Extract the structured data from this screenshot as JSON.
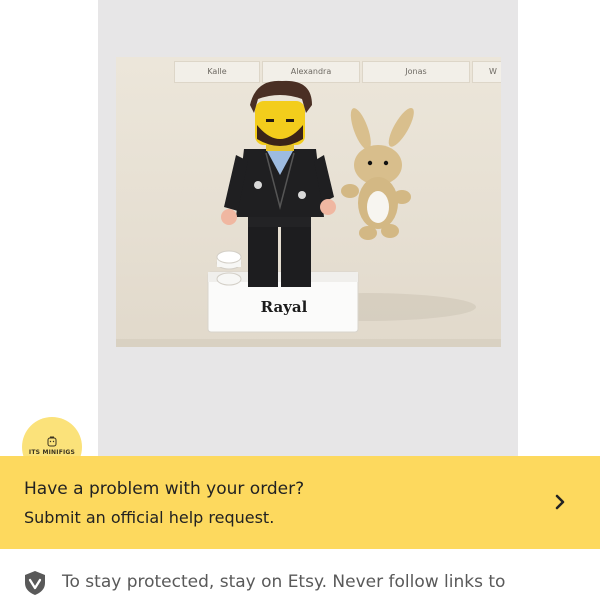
{
  "listing": {
    "photo_labels": [
      "Kalle",
      "Alexandra",
      "Jonas",
      "W"
    ],
    "brick_text": "Rayal"
  },
  "shop": {
    "avatar_text": "ITS MINIFIGS",
    "icon": "minifig-head-icon"
  },
  "help_banner": {
    "title": "Have a problem with your order?",
    "subtitle": "Submit an official help request.",
    "icon": "chevron-right-icon",
    "background": "#fdd95e"
  },
  "notice": {
    "icon": "shield-check-icon",
    "text": "To stay protected, stay on Etsy. Never follow links to"
  }
}
